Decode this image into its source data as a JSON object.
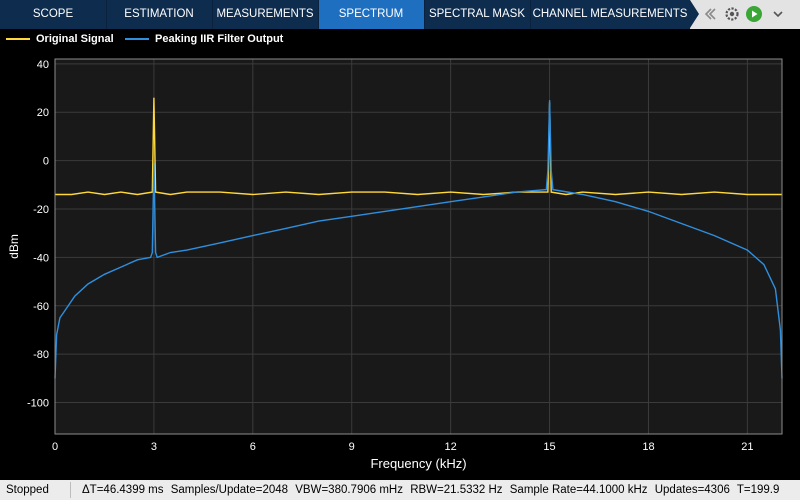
{
  "tabs": [
    {
      "label": "SCOPE",
      "active": false
    },
    {
      "label": "ESTIMATION",
      "active": false
    },
    {
      "label": "MEASUREMENTS",
      "active": false
    },
    {
      "label": "SPECTRUM",
      "active": true
    },
    {
      "label": "SPECTRAL MASK",
      "active": false
    },
    {
      "label": "CHANNEL MEASUREMENTS",
      "active": false
    }
  ],
  "toolbar": {
    "icons": [
      "arrow-left-icon",
      "settings-gear-icon",
      "run-play-icon",
      "chevron-down-icon"
    ]
  },
  "legend": [
    {
      "name": "Original Signal",
      "color": "#ffd83a"
    },
    {
      "name": "Peaking IIR Filter Output",
      "color": "#2f8fde"
    }
  ],
  "chart_data": {
    "type": "line",
    "xlabel": "Frequency (kHz)",
    "ylabel": "dBm",
    "xlim": [
      0,
      22.05
    ],
    "ylim": [
      -113,
      42
    ],
    "xticks": [
      0,
      3,
      6,
      9,
      12,
      15,
      18,
      21
    ],
    "yticks": [
      40,
      20,
      0,
      -20,
      -40,
      -60,
      -80,
      -100
    ],
    "grid": true,
    "legend_position": "top-left",
    "background": "#191919",
    "series": [
      {
        "name": "Original Signal",
        "color": "#ffd83a",
        "x": [
          0,
          0.5,
          1,
          1.5,
          2,
          2.5,
          2.95,
          3.0,
          3.05,
          3.5,
          4,
          5,
          6,
          7,
          8,
          9,
          10,
          11,
          12,
          13,
          14,
          14.95,
          15.0,
          15.05,
          15.5,
          16,
          17,
          18,
          19,
          20,
          21,
          21.5,
          22.05
        ],
        "values": [
          -14,
          -14,
          -13,
          -14,
          -13,
          -14,
          -13,
          26,
          -13,
          -14,
          -13,
          -13,
          -14,
          -13,
          -14,
          -13,
          -13,
          -14,
          -13,
          -14,
          -13,
          -13,
          24,
          -13,
          -14,
          -13,
          -14,
          -13,
          -14,
          -13,
          -14,
          -14,
          -14
        ]
      },
      {
        "name": "Peaking IIR Filter Output",
        "color": "#2f8fde",
        "x": [
          0,
          0.05,
          0.15,
          0.3,
          0.6,
          1,
          1.5,
          2,
          2.5,
          2.9,
          2.95,
          3.0,
          3.05,
          3.1,
          3.5,
          4,
          5,
          6,
          7,
          8,
          9,
          10,
          11,
          12,
          13,
          14,
          14.9,
          14.95,
          15.0,
          15.05,
          15.1,
          16,
          17,
          18,
          19,
          20,
          21,
          21.5,
          21.85,
          22.0,
          22.05
        ],
        "values": [
          -90,
          -72,
          -65,
          -62,
          -56,
          -51,
          -47,
          -44,
          -41,
          -40,
          -38,
          -1,
          -38,
          -40,
          -38,
          -37,
          -34,
          -31,
          -28,
          -25,
          -23,
          -21,
          -19,
          -17,
          -15,
          -13,
          -12,
          -4,
          25,
          -4,
          -12,
          -14,
          -17,
          -21,
          -26,
          -31,
          -37,
          -43,
          -53,
          -70,
          -90
        ]
      }
    ]
  },
  "status": {
    "state": "Stopped",
    "measurements": [
      "ΔT=46.4399 ms",
      "Samples/Update=2048",
      "VBW=380.7906 mHz",
      "RBW=21.5332 Hz",
      "Sample Rate=44.1000 kHz",
      "Updates=4306",
      "T=199.9"
    ]
  }
}
